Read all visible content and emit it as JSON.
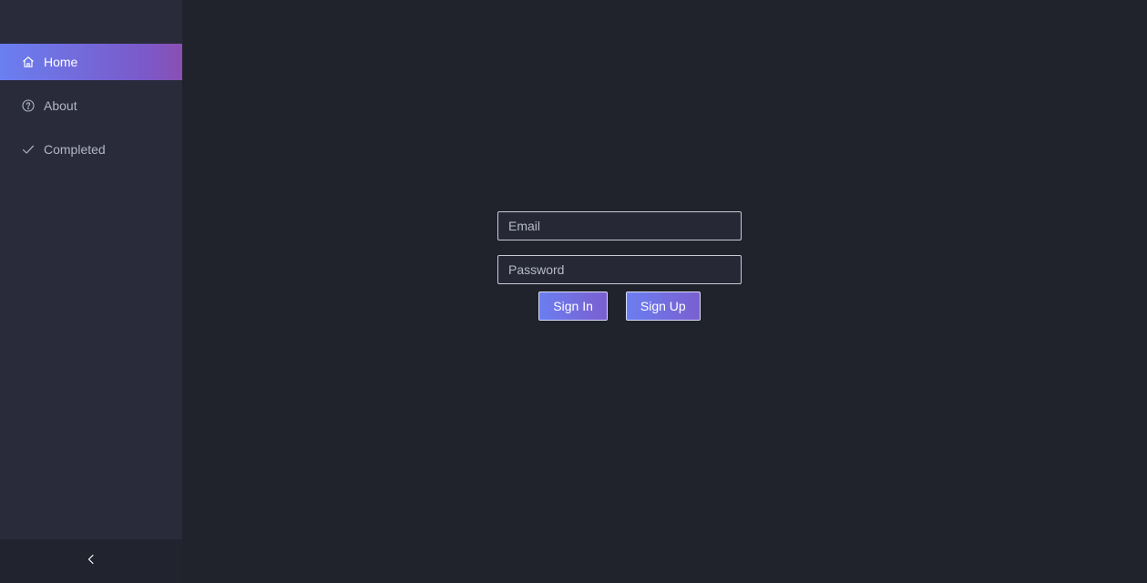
{
  "sidebar": {
    "items": [
      {
        "label": "Home",
        "icon": "home-icon",
        "active": true
      },
      {
        "label": "About",
        "icon": "question-circle-icon",
        "active": false
      },
      {
        "label": "Completed",
        "icon": "check-icon",
        "active": false
      }
    ],
    "collapse_icon": "chevron-left-icon"
  },
  "login": {
    "email_placeholder": "Email",
    "password_placeholder": "Password",
    "sign_in_label": "Sign In",
    "sign_up_label": "Sign Up"
  },
  "colors": {
    "background": "#20222c",
    "sidebar": "#292b3a",
    "accent_start": "#6a7ff0",
    "accent_end": "#8a4fb3"
  }
}
